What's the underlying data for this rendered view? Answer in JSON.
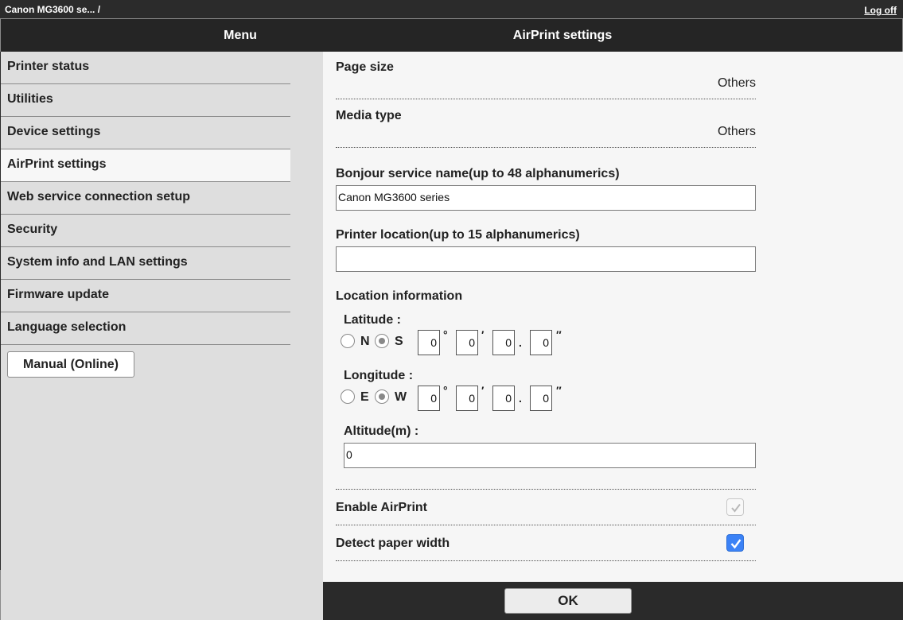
{
  "topbar": {
    "device": "Canon MG3600 se... /",
    "logoff": "Log off"
  },
  "header": {
    "menu_title": "Menu",
    "page_title": "AirPrint settings"
  },
  "sidebar": {
    "items": [
      {
        "label": "Printer status"
      },
      {
        "label": "Utilities"
      },
      {
        "label": "Device settings"
      },
      {
        "label": "AirPrint settings"
      },
      {
        "label": "Web service connection setup"
      },
      {
        "label": "Security"
      },
      {
        "label": "System info and LAN settings"
      },
      {
        "label": "Firmware update"
      },
      {
        "label": "Language selection"
      }
    ],
    "active_item": "AirPrint settings",
    "manual_button": "Manual (Online)"
  },
  "main": {
    "page_size": {
      "label": "Page size",
      "value": "Others"
    },
    "media_type": {
      "label": "Media type",
      "value": "Others"
    },
    "bonjour": {
      "label": "Bonjour service name(up to 48 alphanumerics)",
      "value": "Canon MG3600 series"
    },
    "printer_location": {
      "label": "Printer location(up to 15 alphanumerics)",
      "value": ""
    },
    "location_info": {
      "label": "Location information",
      "latitude": {
        "label": "Latitude :",
        "options": [
          "N",
          "S"
        ],
        "selected": "S",
        "degrees": "0",
        "minutes": "0",
        "seconds": "0",
        "fraction": "0"
      },
      "longitude": {
        "label": "Longitude :",
        "options": [
          "E",
          "W"
        ],
        "selected": "W",
        "degrees": "0",
        "minutes": "0",
        "seconds": "0",
        "fraction": "0"
      },
      "altitude": {
        "label": "Altitude(m) :",
        "value": "0"
      },
      "symbols": {
        "degree": "°",
        "minute": "′",
        "dot": ".",
        "second": "″"
      }
    },
    "enable_airprint": {
      "label": "Enable AirPrint",
      "checked": true,
      "disabled": true
    },
    "detect_paper_width": {
      "label": "Detect paper width",
      "checked": true
    }
  },
  "footer": {
    "ok_label": "OK"
  },
  "colors": {
    "checkbox_accent": "#3b82f6",
    "header_bg": "#252525",
    "sidebar_bg": "#dedede",
    "content_bg": "#f6f6f6"
  },
  "icons": {
    "checkmark": "check-icon"
  }
}
